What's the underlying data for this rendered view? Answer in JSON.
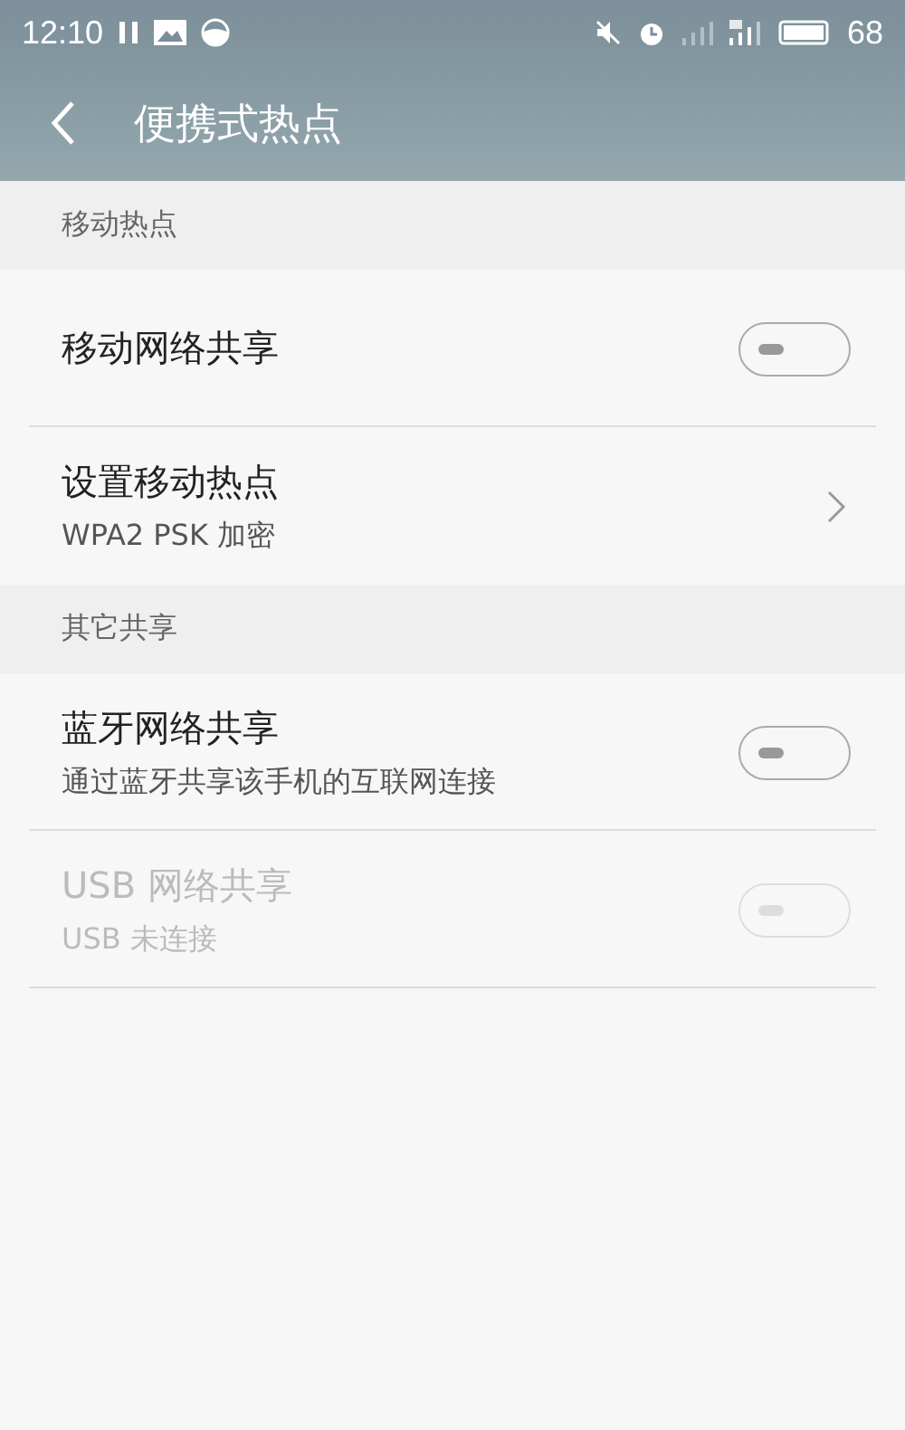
{
  "status_bar": {
    "time": "12:10",
    "battery_level": "68"
  },
  "header": {
    "title": "便携式热点"
  },
  "sections": [
    {
      "title": "移动热点",
      "items": [
        {
          "kind": "toggle",
          "label": "移动网络共享",
          "on": false,
          "disabled": false
        },
        {
          "kind": "link",
          "label": "设置移动热点",
          "subtitle": "WPA2 PSK 加密"
        }
      ]
    },
    {
      "title": "其它共享",
      "items": [
        {
          "kind": "toggle",
          "label": "蓝牙网络共享",
          "subtitle": "通过蓝牙共享该手机的互联网连接",
          "on": false,
          "disabled": false
        },
        {
          "kind": "toggle",
          "label": "USB 网络共享",
          "subtitle": "USB 未连接",
          "on": false,
          "disabled": true
        }
      ]
    }
  ]
}
